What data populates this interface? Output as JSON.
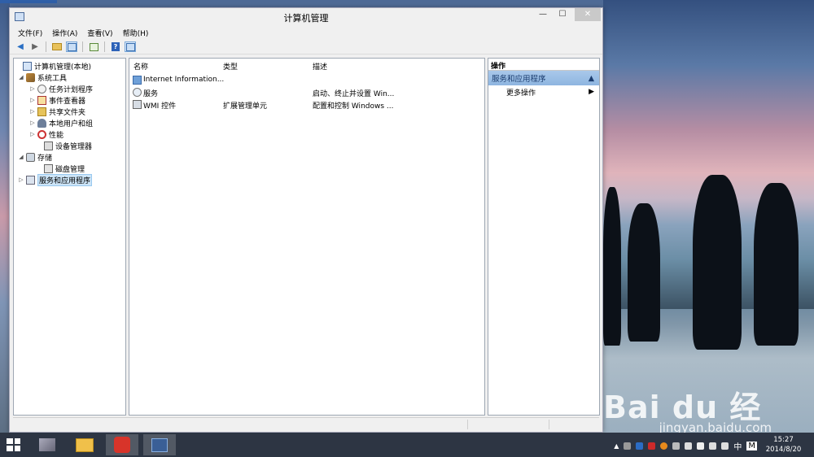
{
  "window": {
    "title": "计算机管理",
    "controls": {
      "minimize": "—",
      "maximize": "☐",
      "close": "✕"
    }
  },
  "menu": [
    {
      "label": "文件(F)"
    },
    {
      "label": "操作(A)"
    },
    {
      "label": "查看(V)"
    },
    {
      "label": "帮助(H)"
    }
  ],
  "toolbar": {
    "buttons": [
      "back-icon",
      "forward-icon",
      "up-folder-icon",
      "show-hide-tree-icon",
      "export-list-icon",
      "help-icon",
      "show-hide-action-pane-icon"
    ]
  },
  "tree": [
    {
      "label": "计算机管理(本地)",
      "level": 0,
      "twisty": "",
      "icon": "computer-management-icon"
    },
    {
      "label": "系统工具",
      "level": 1,
      "twisty": "◢",
      "icon": "system-tools-icon"
    },
    {
      "label": "任务计划程序",
      "level": 2,
      "twisty": "▷",
      "icon": "task-scheduler-icon"
    },
    {
      "label": "事件查看器",
      "level": 2,
      "twisty": "▷",
      "icon": "event-viewer-icon"
    },
    {
      "label": "共享文件夹",
      "level": 2,
      "twisty": "▷",
      "icon": "shared-folders-icon"
    },
    {
      "label": "本地用户和组",
      "level": 2,
      "twisty": "▷",
      "icon": "local-users-groups-icon"
    },
    {
      "label": "性能",
      "level": 2,
      "twisty": "▷",
      "icon": "performance-icon"
    },
    {
      "label": "设备管理器",
      "level": 2,
      "twisty": "",
      "icon": "device-manager-icon"
    },
    {
      "label": "存储",
      "level": 1,
      "twisty": "◢",
      "icon": "storage-icon"
    },
    {
      "label": "磁盘管理",
      "level": 2,
      "twisty": "",
      "icon": "disk-management-icon"
    },
    {
      "label": "服务和应用程序",
      "level": 1,
      "twisty": "▷",
      "icon": "services-applications-icon",
      "selected": true
    }
  ],
  "list": {
    "columns": [
      "名称",
      "类型",
      "描述"
    ],
    "rows": [
      {
        "name": "Internet Information...",
        "type": "",
        "desc": "",
        "icon": "iis-icon"
      },
      {
        "name": "服务",
        "type": "",
        "desc": "启动、终止并设置 Win...",
        "icon": "services-icon"
      },
      {
        "name": "WMI 控件",
        "type": "扩展管理单元",
        "desc": "配置和控制 Windows ...",
        "icon": "wmi-control-icon"
      }
    ]
  },
  "actions": {
    "header": "操作",
    "group": "服务和应用程序",
    "items": [
      {
        "label": "更多操作"
      }
    ]
  },
  "watermark": {
    "logo": "Bai du 经验",
    "url": "jingyan.baidu.com"
  },
  "taskbar": {
    "apps": [
      "app-icon-1",
      "file-explorer-icon",
      "app-icon-red",
      "computer-management-icon"
    ],
    "ime": "中",
    "ime2": "M",
    "time": "15:27",
    "date": "2014/8/20"
  },
  "colors": {
    "selection": "#cce4f7",
    "action_group": "#a9c8ea",
    "taskbar": "#2c3442"
  }
}
